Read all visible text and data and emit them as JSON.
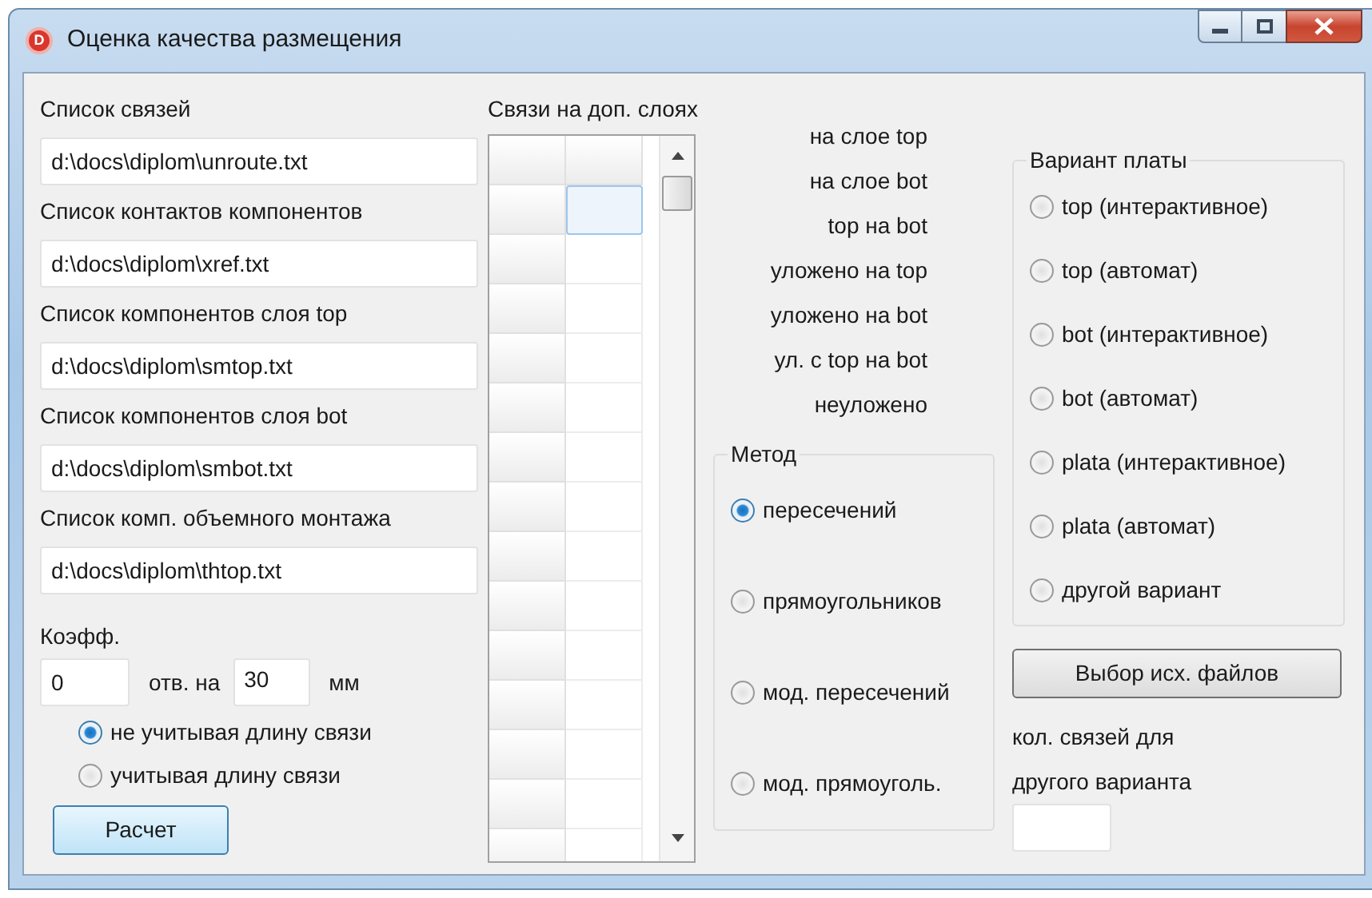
{
  "window": {
    "title": "Оценка качества размещения",
    "icon_letter": "D"
  },
  "files": [
    {
      "label": "Список связей",
      "value": "d:\\docs\\diplom\\unroute.txt"
    },
    {
      "label": "Список контактов компонентов",
      "value": "d:\\docs\\diplom\\xref.txt"
    },
    {
      "label": "Список компонентов слоя top",
      "value": "d:\\docs\\diplom\\smtop.txt"
    },
    {
      "label": "Список компонентов слоя bot",
      "value": "d:\\docs\\diplom\\smbot.txt"
    },
    {
      "label": "Список комп. объемного монтажа",
      "value": "d:\\docs\\diplom\\thtop.txt"
    }
  ],
  "coeff": {
    "label": "Коэфф.",
    "holes": "0",
    "holes_label": "отв. на",
    "length": "30",
    "unit": "мм"
  },
  "length_options": [
    {
      "label": "не учитывая длину связи",
      "selected": true
    },
    {
      "label": "учитывая длину связи",
      "selected": false
    }
  ],
  "calc_button": "Расчет",
  "grid": {
    "title": "Связи на доп. слоях",
    "rows": [
      {
        "selected": true
      },
      {
        "selected": false
      },
      {
        "selected": false
      },
      {
        "selected": false
      },
      {
        "selected": false
      },
      {
        "selected": false
      },
      {
        "selected": false
      },
      {
        "selected": false
      },
      {
        "selected": false
      },
      {
        "selected": false
      },
      {
        "selected": false
      },
      {
        "selected": false
      },
      {
        "selected": false
      },
      {
        "selected": false
      }
    ]
  },
  "stats": [
    "на слое top",
    "на слое bot",
    "top на bot",
    "уложено на top",
    "уложено на bot",
    "ул. с top на bot",
    "неуложено"
  ],
  "method": {
    "title": "Метод",
    "options": [
      {
        "label": "пересечений",
        "selected": true
      },
      {
        "label": "прямоугольников",
        "selected": false
      },
      {
        "label": "мод. пересечений",
        "selected": false
      },
      {
        "label": "мод. прямоуголь.",
        "selected": false
      }
    ]
  },
  "board_variant": {
    "title": "Вариант платы",
    "options": [
      {
        "label": "top (интерактивное)",
        "selected": false
      },
      {
        "label": "top (автомат)",
        "selected": false
      },
      {
        "label": "bot (интерактивное)",
        "selected": false
      },
      {
        "label": "bot (автомат)",
        "selected": false
      },
      {
        "label": "plata (интерактивное)",
        "selected": false
      },
      {
        "label": "plata (автомат)",
        "selected": false
      },
      {
        "label": "другой вариант",
        "selected": false
      }
    ]
  },
  "source_button": "Выбор исх. файлов",
  "other_count": {
    "label_1": "кол. связей для",
    "label_2": "другого варианта"
  }
}
